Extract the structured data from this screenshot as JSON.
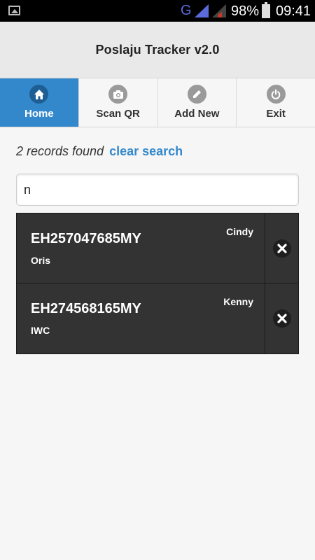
{
  "status_bar": {
    "network": "G",
    "battery": "98%",
    "time": "09:41"
  },
  "header": {
    "title": "Poslaju Tracker v2.0"
  },
  "nav": {
    "items": [
      {
        "label": "Home",
        "icon": "home-icon",
        "active": true
      },
      {
        "label": "Scan QR",
        "icon": "camera-icon",
        "active": false
      },
      {
        "label": "Add New",
        "icon": "pencil-icon",
        "active": false
      },
      {
        "label": "Exit",
        "icon": "power-icon",
        "active": false
      }
    ]
  },
  "results": {
    "count_text": "2 records found",
    "clear_label": "clear search"
  },
  "search": {
    "value": "n"
  },
  "records": [
    {
      "tracking": "EH257047685MY",
      "courier": "Oris",
      "person": "Cindy"
    },
    {
      "tracking": "EH274568165MY",
      "courier": "IWC",
      "person": "Kenny"
    }
  ],
  "colors": {
    "accent": "#3388cc",
    "list_bg": "#333333"
  }
}
